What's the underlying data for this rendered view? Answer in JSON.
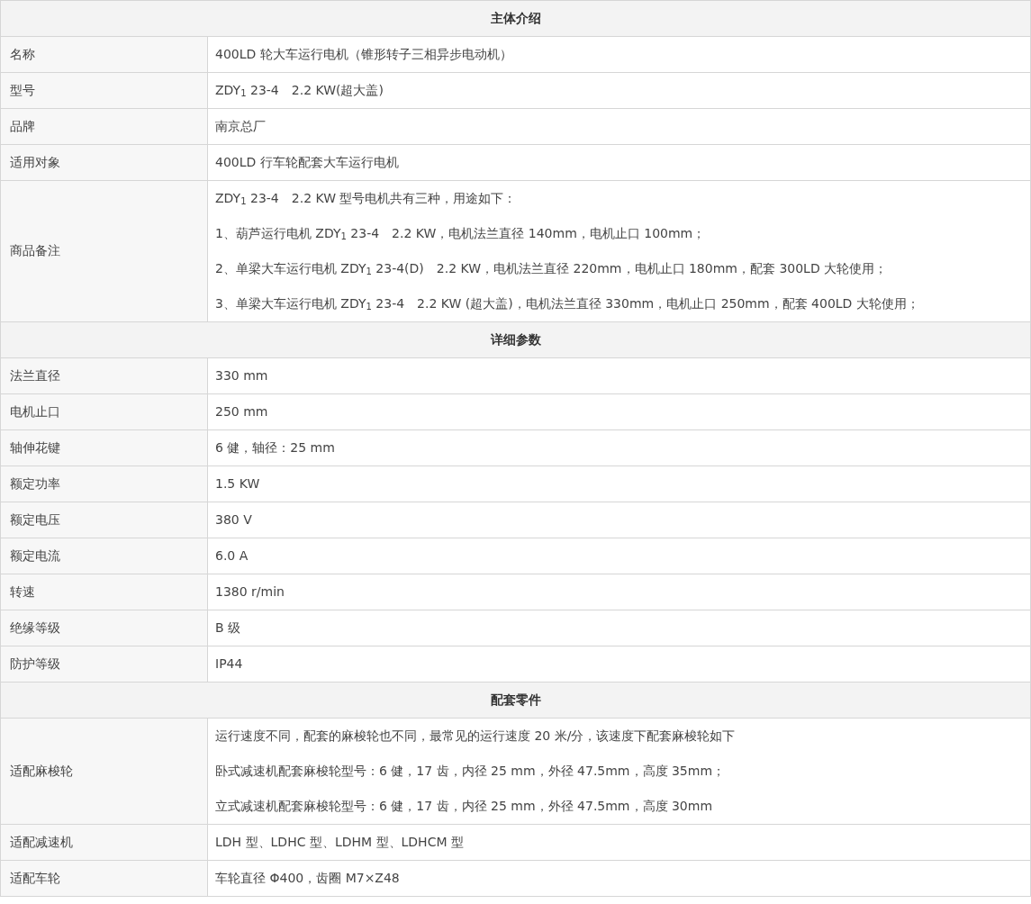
{
  "sections": [
    {
      "title": "主体介绍",
      "rows": [
        {
          "label": "名称",
          "lines": [
            "400LD 轮大车运行电机（锥形转子三相异步电动机）"
          ]
        },
        {
          "label": "型号",
          "lines": [
            "ZDY$_{1}$ 23-4　2.2 KW(超大盖)"
          ]
        },
        {
          "label": "品牌",
          "lines": [
            "南京总厂"
          ]
        },
        {
          "label": "适用对象",
          "lines": [
            "400LD 行车轮配套大车运行电机"
          ]
        },
        {
          "label": "商品备注",
          "lines": [
            "ZDY$_{1}$ 23-4　2.2 KW 型号电机共有三种，用途如下：",
            "1、葫芦运行电机 ZDY$_{1}$ 23-4　2.2 KW，电机法兰直径 140mm，电机止口 100mm；",
            "2、单梁大车运行电机 ZDY$_{1}$ 23-4(D)　2.2 KW，电机法兰直径 220mm，电机止口 180mm，配套 300LD 大轮使用；",
            "3、单梁大车运行电机 ZDY$_{1}$ 23-4　2.2 KW (超大盖)，电机法兰直径 330mm，电机止口 250mm，配套 400LD 大轮使用；"
          ]
        }
      ]
    },
    {
      "title": "详细参数",
      "rows": [
        {
          "label": "法兰直径",
          "lines": [
            "330 mm"
          ]
        },
        {
          "label": "电机止口",
          "lines": [
            "250 mm"
          ]
        },
        {
          "label": "轴伸花键",
          "lines": [
            "6 健，轴径：25 mm"
          ]
        },
        {
          "label": "额定功率",
          "lines": [
            "1.5 KW"
          ]
        },
        {
          "label": "额定电压",
          "lines": [
            "380 V"
          ]
        },
        {
          "label": "额定电流",
          "lines": [
            "6.0 A"
          ]
        },
        {
          "label": "转速",
          "lines": [
            "1380 r/min"
          ]
        },
        {
          "label": "绝缘等级",
          "lines": [
            "B 级"
          ]
        },
        {
          "label": "防护等级",
          "lines": [
            "IP44"
          ]
        }
      ]
    },
    {
      "title": "配套零件",
      "rows": [
        {
          "label": "适配麻梭轮",
          "lines": [
            "运行速度不同，配套的麻梭轮也不同，最常见的运行速度 20 米/分，该速度下配套麻梭轮如下",
            "卧式减速机配套麻梭轮型号：6 健，17 齿，内径 25 mm，外径 47.5mm，高度 35mm；",
            "立式减速机配套麻梭轮型号：6 健，17 齿，内径 25 mm，外径 47.5mm，高度 30mm"
          ]
        },
        {
          "label": "适配减速机",
          "lines": [
            "LDH 型、LDHC 型、LDHM 型、LDHCM 型"
          ]
        },
        {
          "label": "适配车轮",
          "lines": [
            "车轮直径 Φ400，齿圈 M7×Z48"
          ]
        }
      ]
    }
  ]
}
